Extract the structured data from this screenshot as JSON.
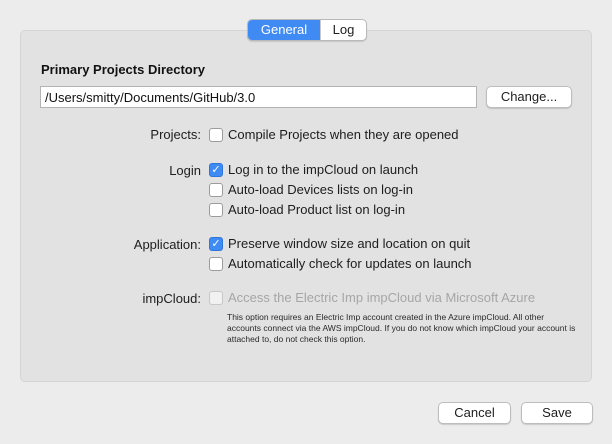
{
  "tabs": {
    "general": "General",
    "log": "Log"
  },
  "directory": {
    "heading": "Primary Projects Directory",
    "path": "/Users/smitty/Documents/GitHub/3.0",
    "change_label": "Change..."
  },
  "projects": {
    "label": "Projects:",
    "options": [
      {
        "text": "Compile Projects when they are opened",
        "checked": false
      }
    ]
  },
  "login": {
    "label": "Login",
    "options": [
      {
        "text": "Log in to the impCloud on launch",
        "checked": true
      },
      {
        "text": "Auto-load Devices lists on log-in",
        "checked": false
      },
      {
        "text": "Auto-load Product list on log-in",
        "checked": false
      }
    ]
  },
  "application": {
    "label": "Application:",
    "options": [
      {
        "text": "Preserve window size and location on quit",
        "checked": true
      },
      {
        "text": "Automatically check for updates on launch",
        "checked": false
      }
    ]
  },
  "impcloud": {
    "label": "impCloud:",
    "option": {
      "text": "Access the Electric Imp impCloud via Microsoft Azure",
      "checked": false,
      "disabled": true
    },
    "note": "This option requires an Electric Imp account created in the Azure impCloud. All other accounts connect via the AWS impCloud. If you do not know which impCloud your account is attached to, do not check this option."
  },
  "footer": {
    "cancel_label": "Cancel",
    "save_label": "Save"
  },
  "colors": {
    "accent": "#3f8bf3",
    "window_bg": "#ececec",
    "group_bg": "#e2e2e2"
  },
  "icons": {
    "checked": "checkmark-icon"
  }
}
